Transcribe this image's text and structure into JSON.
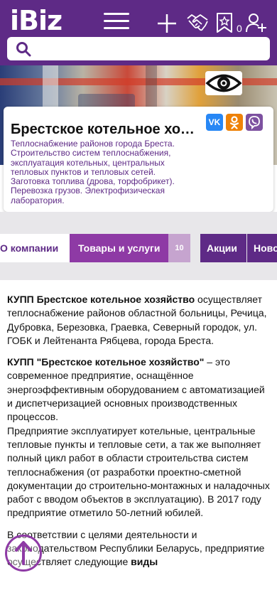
{
  "header": {
    "logo": "iBiz",
    "favorites_count": "0",
    "icons": [
      "menu-icon",
      "plus-icon",
      "handshake-icon",
      "bookmark-star-icon",
      "add-user-icon"
    ]
  },
  "search": {
    "placeholder": "",
    "value": ""
  },
  "company": {
    "name": "Брестское котельное хозяйство",
    "description": "Теплоснабжение районов города Бреста. Строительство систем теплоснабжения, эксплуатация котельных, центральных тепловых пунктов и тепловых сетей. Заготовка топлива (дрова, торфобрикет). Перевозка грузов. Электрофизическая лаборатория.",
    "social": [
      {
        "name": "vk",
        "label": "VK",
        "color": "#2787f5"
      },
      {
        "name": "ok",
        "label": "OK",
        "color": "#ee8208"
      },
      {
        "name": "viber",
        "label": "",
        "color": "#7d51a0"
      }
    ]
  },
  "tabs": [
    {
      "label": "О компании",
      "active": true
    },
    {
      "label": "Товары и услуги",
      "count": "10"
    },
    {
      "label": "Акции"
    },
    {
      "label": "Новости"
    }
  ],
  "content": {
    "p1_bold": "КУПП Брестское котельное хозяйство",
    "p1_text": " осуществляет теплоснабжение районов областной больницы, Речица, Дубровка, Березовка, Граевка, Северный городок, ул. ГОБК и Лейтенанта Рябцева, города Бреста.",
    "p2_bold": "КУПП \"Брестское котельное хозяйство\"",
    "p2_text": " – это современное предприятие, оснащённое энергоэффективным оборудованием с автоматизацией и диспетчеризацией основных производственных процессов.",
    "p2_text2": "Предприятие эксплуатирует котельные, центральные тепловые пункты и тепловые сети, а так же выполняет полный цикл работ в области строительства систем теплоснабжения (от разработки проектно-сметной документации до строительно-монтажных и наладочных работ с вводом объектов в эксплуатацию). В 2017 году предприятие отметило 50-летний юбилей.",
    "p3_text": "В соответствии с целями деятельности и законодательством Республики Беларусь, предприятие осуществляет следующие ",
    "p3_bold": "виды"
  },
  "colors": {
    "brand": "#5e2a86",
    "accent": "#8e3aa5"
  }
}
